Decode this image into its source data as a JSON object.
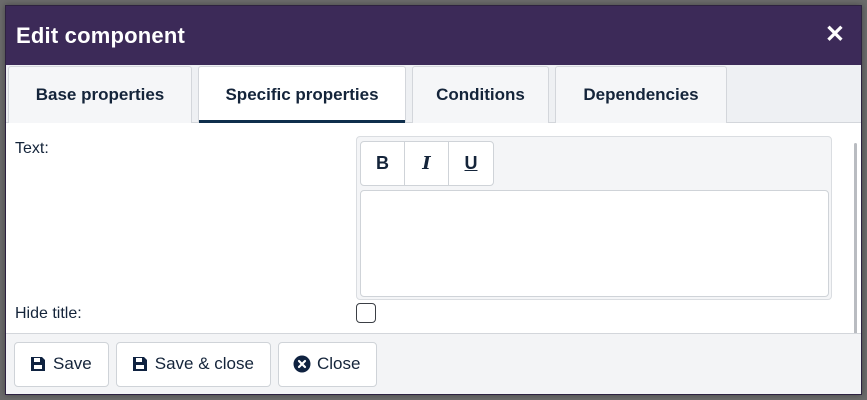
{
  "dialog": {
    "title": "Edit component",
    "close_glyph": "✕"
  },
  "tabs": [
    {
      "label": "Base properties",
      "active": false
    },
    {
      "label": "Specific properties",
      "active": true
    },
    {
      "label": "Conditions",
      "active": false
    },
    {
      "label": "Dependencies",
      "active": false
    }
  ],
  "form": {
    "text_label": "Text:",
    "text_value": "",
    "toolbar": {
      "bold": "B",
      "italic": "I",
      "underline": "U"
    },
    "hide_title_label": "Hide title:",
    "hide_title_checked": false
  },
  "footer": {
    "save_label": "Save",
    "save_close_label": "Save & close",
    "close_label": "Close"
  },
  "icons": {
    "close": "close-icon",
    "save": "floppy-disk-icon",
    "close_circle": "x-circle-icon"
  },
  "colors": {
    "titlebar": "#3c2a58",
    "active_tab_indicator": "#0f2f4c",
    "text": "#14243a"
  }
}
